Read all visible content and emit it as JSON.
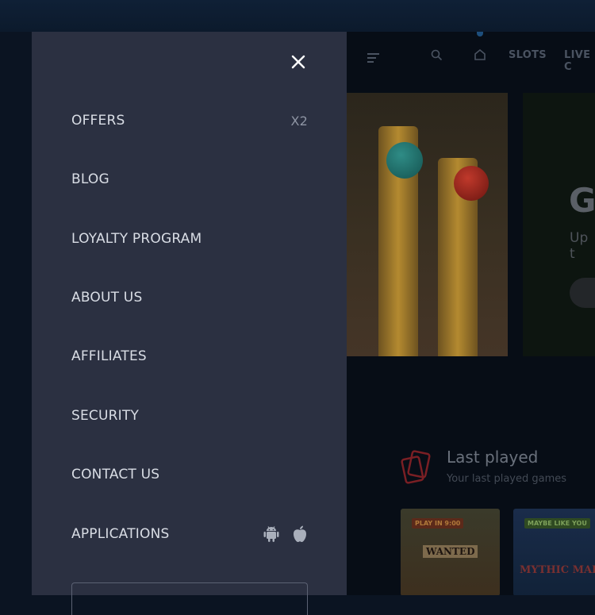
{
  "nav": {
    "slots_label": "SLOTS",
    "live_label": "LIVE C"
  },
  "menu": {
    "items": [
      {
        "label": "OFFERS",
        "badge": "X2"
      },
      {
        "label": "BLOG"
      },
      {
        "label": "LOYALTY PROGRAM"
      },
      {
        "label": "ABOUT US"
      },
      {
        "label": "AFFILIATES"
      },
      {
        "label": "SECURITY"
      },
      {
        "label": "CONTACT US"
      },
      {
        "label": "APPLICATIONS",
        "icons": [
          "android-icon",
          "apple-icon"
        ]
      }
    ]
  },
  "hero": {
    "headline": "G",
    "subline": "Up t"
  },
  "last_played": {
    "title": "Last played",
    "subtitle": "Your last played games",
    "cards": [
      {
        "tag": "PLAY IN 9:00",
        "name": "WANTED"
      },
      {
        "tag": "MAYBE LIKE YOU",
        "name": "MYTHIC MAIDEN"
      }
    ]
  },
  "colors": {
    "menu_bg": "#2b3041",
    "menu_text": "#d9dde5",
    "accent_red": "#c2272d"
  }
}
